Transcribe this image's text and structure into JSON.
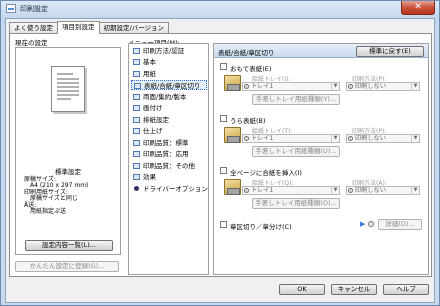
{
  "window": {
    "title": "印刷設定",
    "close_glyph": "✕",
    "icon": "printer-settings-icon"
  },
  "tabs": [
    {
      "label": "よく使う設定"
    },
    {
      "label": "項目別設定"
    },
    {
      "label": "初期設定/バージョン"
    }
  ],
  "left": {
    "current_settings_label": "現在の設定",
    "standard_label": "標準設定",
    "info_lines": [
      "原稿サイズ:",
      "　A4 (210 x 297 mm)",
      "印刷用紙サイズ:",
      "　原稿サイズと同じ",
      "Å送:",
      "　用紙指定ぷ送"
    ],
    "list_settings_button": "設定内容一覧(L)...",
    "register_button": "かんたん設定に登録(G)..."
  },
  "menu": {
    "label": "メニュー項目(M):",
    "items": [
      {
        "label": "印刷方法/認証",
        "icon": "print-method-icon"
      },
      {
        "label": "基本",
        "icon": "basic-icon"
      },
      {
        "label": "用紙",
        "icon": "paper-icon"
      },
      {
        "label": "表紙/合紙/章区切り",
        "icon": "cover-icon",
        "selected": true
      },
      {
        "label": "両面/集約/製本",
        "icon": "duplex-icon"
      },
      {
        "label": "画付け",
        "icon": "layout-icon"
      },
      {
        "label": "排紙設定",
        "icon": "output-icon"
      },
      {
        "label": "仕上げ",
        "icon": "finishing-icon"
      },
      {
        "label": "印刷品質：標準",
        "icon": "quality-standard-icon"
      },
      {
        "label": "印刷品質：応用",
        "icon": "quality-advanced-icon"
      },
      {
        "label": "印刷品質：その他",
        "icon": "quality-other-icon"
      },
      {
        "label": "効果",
        "icon": "effect-icon"
      },
      {
        "label": "ドライバーオプション",
        "icon": "driver-option-icon"
      }
    ]
  },
  "panel": {
    "title": "表紙/合紙/章区切り",
    "restore_button": "標準に戻す(E)",
    "sections": [
      {
        "label": "おもて表紙(E)",
        "tray_label": "給紙トレイ(I):",
        "tray_value": "トレイ1",
        "print_label": "印刷方法(P):",
        "print_value": "印刷しない",
        "button": "手差しトレイ用紙種類(Y)..."
      },
      {
        "label": "うら表紙(B)",
        "tray_label": "給紙トレイ(T):",
        "tray_value": "トレイ1",
        "print_label": "印刷方法(P):",
        "print_value": "印刷しない",
        "button": "手差しトレイ用紙種類(U)..."
      },
      {
        "label": "全ページに合紙を挿入(I)",
        "tray_label": "給紙トレイ(Q):",
        "tray_value": "トレイ1",
        "print_label": "印刷方法(A):",
        "print_value": "印刷しない",
        "button": "手差しトレイ用紙種類(O)..."
      }
    ],
    "chapter_label": "章区切り／章分け(C)",
    "details_button": "詳細(D)..."
  },
  "footer": {
    "ok": "OK",
    "cancel": "キャンセル",
    "help": "ヘルプ"
  }
}
